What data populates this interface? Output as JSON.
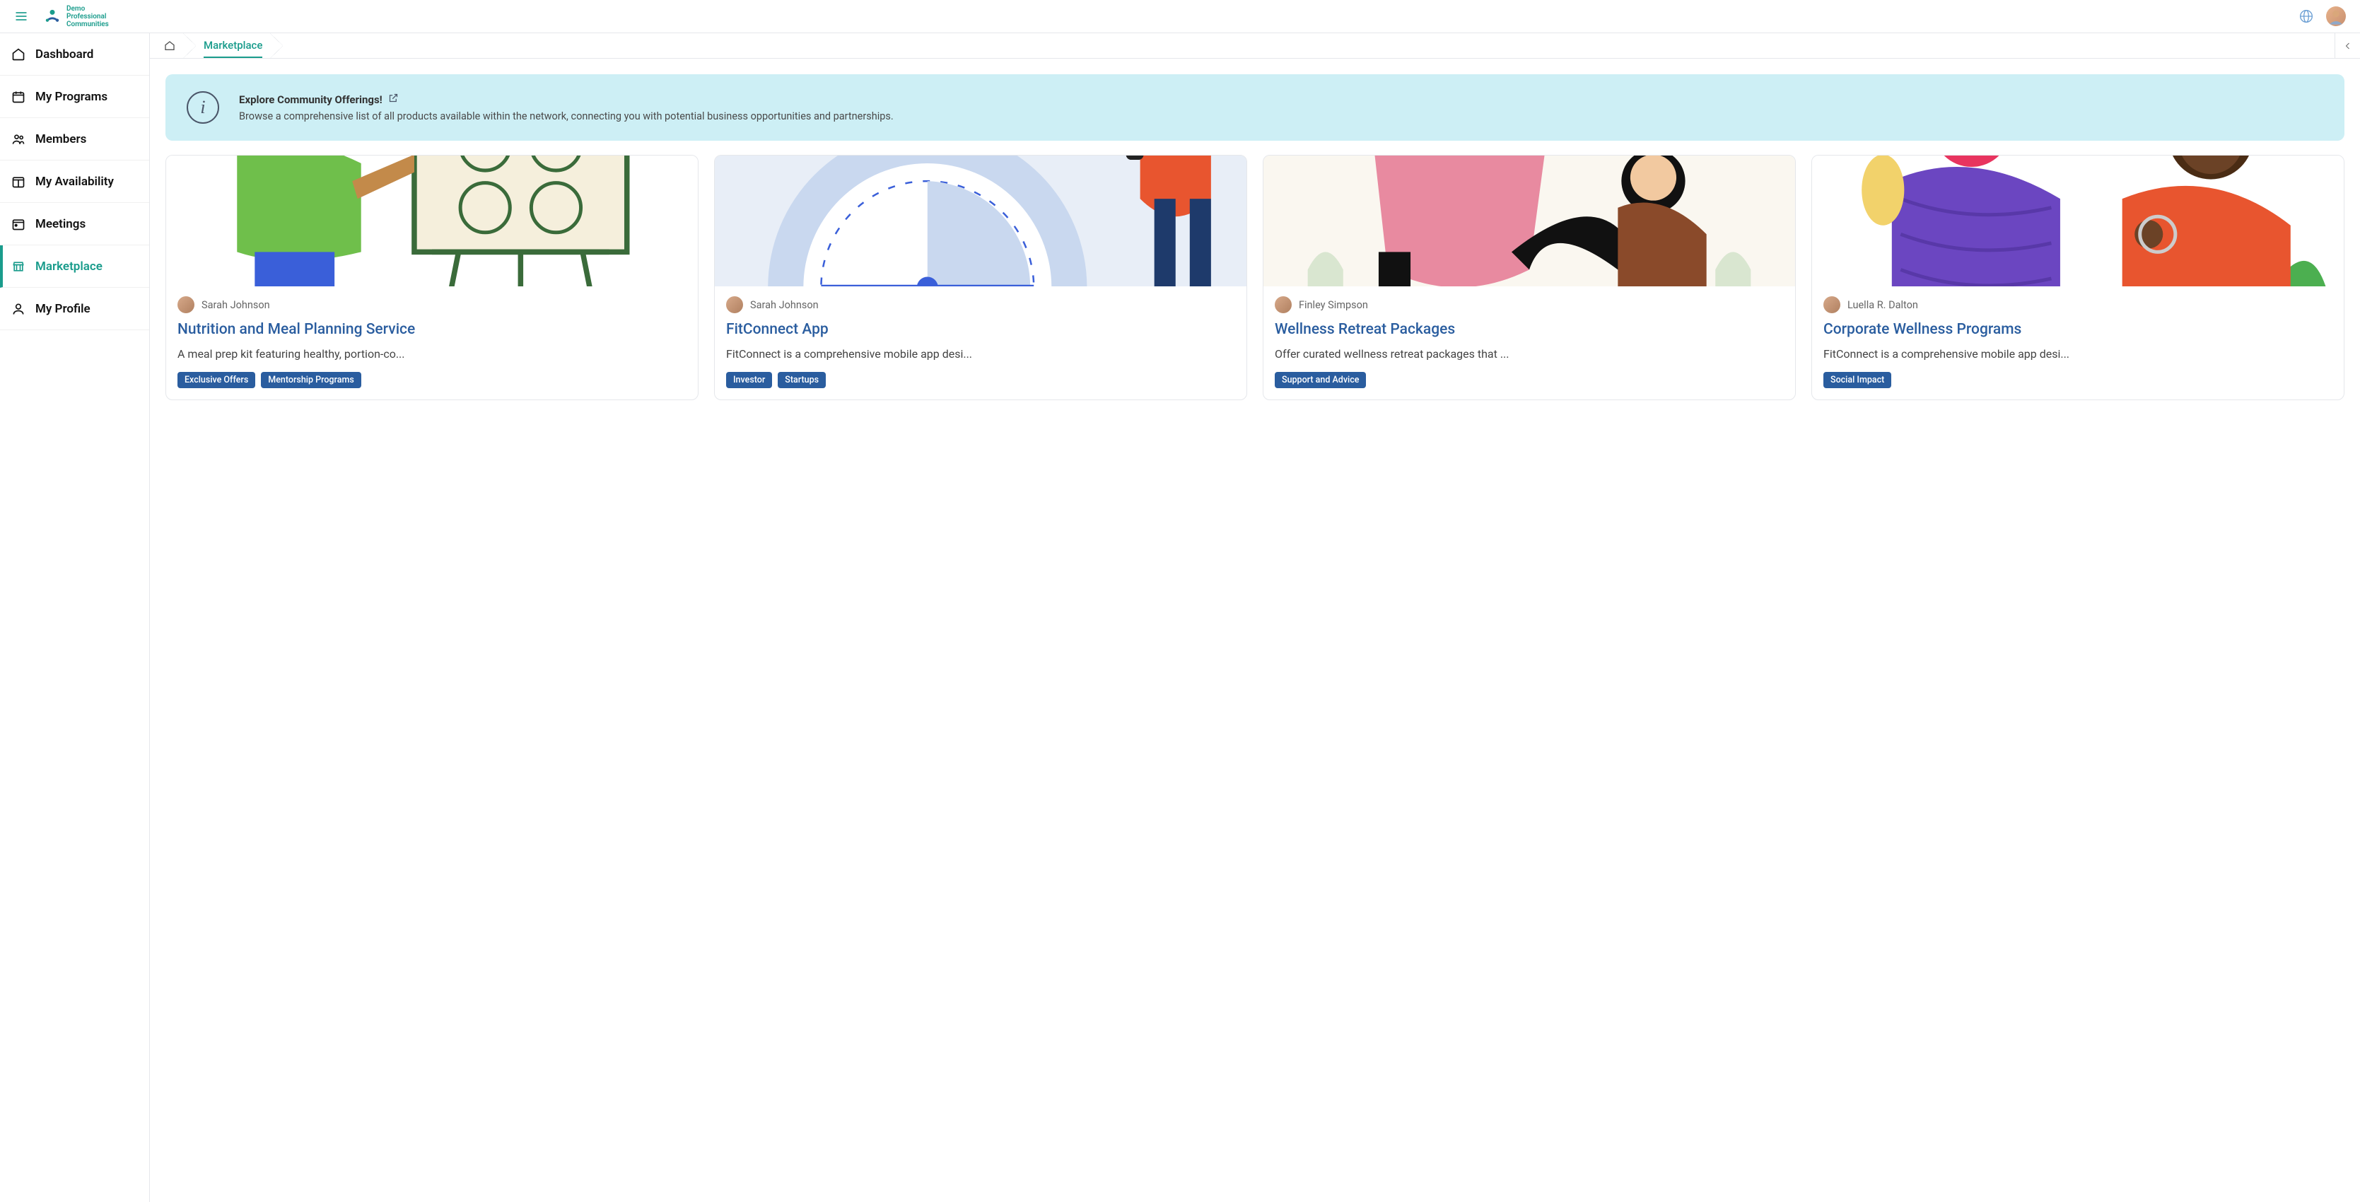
{
  "brand": {
    "line1": "Demo",
    "line2": "Professional",
    "line3": "Communities"
  },
  "sidebar": {
    "items": [
      {
        "label": "Dashboard"
      },
      {
        "label": "My Programs"
      },
      {
        "label": "Members"
      },
      {
        "label": "My Availability"
      },
      {
        "label": "Meetings"
      },
      {
        "label": "Marketplace"
      },
      {
        "label": "My Profile"
      }
    ]
  },
  "breadcrumb": {
    "current": "Marketplace"
  },
  "banner": {
    "title": "Explore Community Offerings!",
    "desc": "Browse a comprehensive list of all products available within the network, connecting you with potential business opportunities and partnerships."
  },
  "cards": [
    {
      "author": "Sarah Johnson",
      "title": "Nutrition and Meal Planning Service",
      "desc": "A meal prep kit featuring healthy, portion-co...",
      "tags": [
        "Exclusive Offers",
        "Mentorship Programs"
      ]
    },
    {
      "author": "Sarah Johnson",
      "title": "FitConnect App",
      "desc": "FitConnect is a comprehensive mobile app desi...",
      "tags": [
        "Investor",
        "Startups"
      ]
    },
    {
      "author": "Finley Simpson",
      "title": "Wellness Retreat Packages",
      "desc": "Offer curated wellness retreat packages that ...",
      "tags": [
        "Support and Advice"
      ]
    },
    {
      "author": "Luella R. Dalton",
      "title": "Corporate Wellness Programs",
      "desc": "FitConnect is a comprehensive mobile app desi...",
      "tags": [
        "Social Impact"
      ]
    }
  ]
}
